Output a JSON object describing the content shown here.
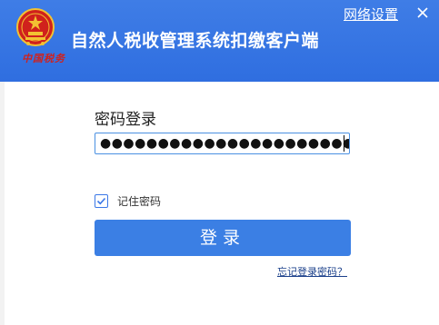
{
  "header": {
    "app_title": "自然人税收管理系统扣缴客户端",
    "brand_text": "中国税务",
    "network_settings_label": "网络设置",
    "close_label": "×"
  },
  "login": {
    "section_title": "密码登录",
    "password_value": "●●●●●●●●●●●●●●●●●●●●●●●",
    "remember_label": "记住密码",
    "remember_checked": true,
    "login_button_label": "登录",
    "forgot_link_label": "忘记登录密码？"
  },
  "colors": {
    "header_blue": "#2f6ee0",
    "button_blue": "#3b7fe4",
    "brand_red": "#d0211c"
  },
  "icons": {
    "emblem": "national-emblem-icon",
    "close": "close-icon",
    "checkbox": "check-icon"
  }
}
